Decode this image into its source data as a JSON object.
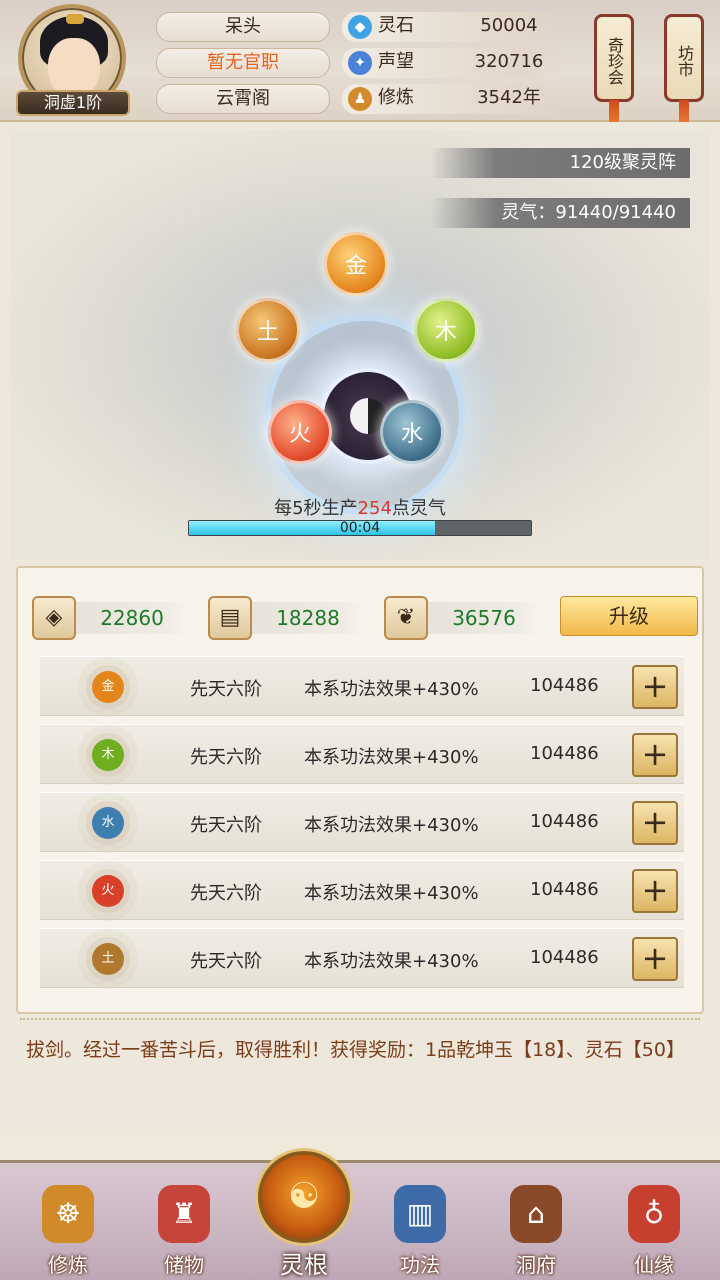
{
  "player": {
    "rank": "洞虚1阶",
    "name": "呆头",
    "title": "暂无官职",
    "sect": "云霄阁"
  },
  "resources": [
    {
      "icon": "spirit-stone-icon",
      "name": "灵石",
      "value": "50004",
      "color": "#3fa3e6"
    },
    {
      "icon": "prestige-icon",
      "name": "声望",
      "value": "320716",
      "color": "#4a82d8"
    },
    {
      "icon": "cultivation-icon",
      "name": "修炼",
      "value": "3542年",
      "color": "#d28a2a"
    }
  ],
  "side_buttons": {
    "treasure": "奇珍会",
    "market": "坊市"
  },
  "array": {
    "level_label": "120级聚灵阵",
    "qi_label": "灵气：91440/91440",
    "elements": {
      "gold": "金",
      "wood": "木",
      "water": "水",
      "fire": "火",
      "earth": "土"
    },
    "production_prefix": "每5秒生产",
    "production_amount": "254",
    "production_suffix": "点灵气",
    "timer": "00:04",
    "progress": 0.72
  },
  "materials": [
    {
      "icon": "ore-icon",
      "glyph": "◈",
      "value": "22860"
    },
    {
      "icon": "wood-icon",
      "glyph": "▤",
      "value": "18288"
    },
    {
      "icon": "herb-icon",
      "glyph": "❦",
      "value": "36576"
    }
  ],
  "upgrade_label": "升级",
  "attributes": [
    {
      "element": "金",
      "grade": "先天六阶",
      "effect": "本系功法效果+430%",
      "power": "104486",
      "color": "#e4851c"
    },
    {
      "element": "木",
      "grade": "先天六阶",
      "effect": "本系功法效果+430%",
      "power": "104486",
      "color": "#6fae1f"
    },
    {
      "element": "水",
      "grade": "先天六阶",
      "effect": "本系功法效果+430%",
      "power": "104486",
      "color": "#3f7fb0"
    },
    {
      "element": "火",
      "grade": "先天六阶",
      "effect": "本系功法效果+430%",
      "power": "104486",
      "color": "#d8402a"
    },
    {
      "element": "土",
      "grade": "先天六阶",
      "effect": "本系功法效果+430%",
      "power": "104486",
      "color": "#b0782e"
    }
  ],
  "plus_label": "+",
  "log_text": "拔剑。经过一番苦斗后，取得胜利！获得奖励：1品乾坤玉【18】、灵石【50】",
  "nav": {
    "items": [
      {
        "label": "修炼",
        "icon": "cultivate-icon",
        "glyph": "☸",
        "color": "#d08a2a"
      },
      {
        "label": "储物",
        "icon": "storage-bag-icon",
        "glyph": "♜",
        "color": "#c6453a"
      },
      {
        "label": "功法",
        "icon": "scroll-book-icon",
        "glyph": "▥",
        "color": "#3f6aa8"
      },
      {
        "label": "洞府",
        "icon": "cave-house-icon",
        "glyph": "⌂",
        "color": "#8a4a2a"
      },
      {
        "label": "仙缘",
        "icon": "gourd-icon",
        "glyph": "♁",
        "color": "#c7402f"
      }
    ],
    "center_label": "灵根",
    "center_glyph": "☯"
  }
}
